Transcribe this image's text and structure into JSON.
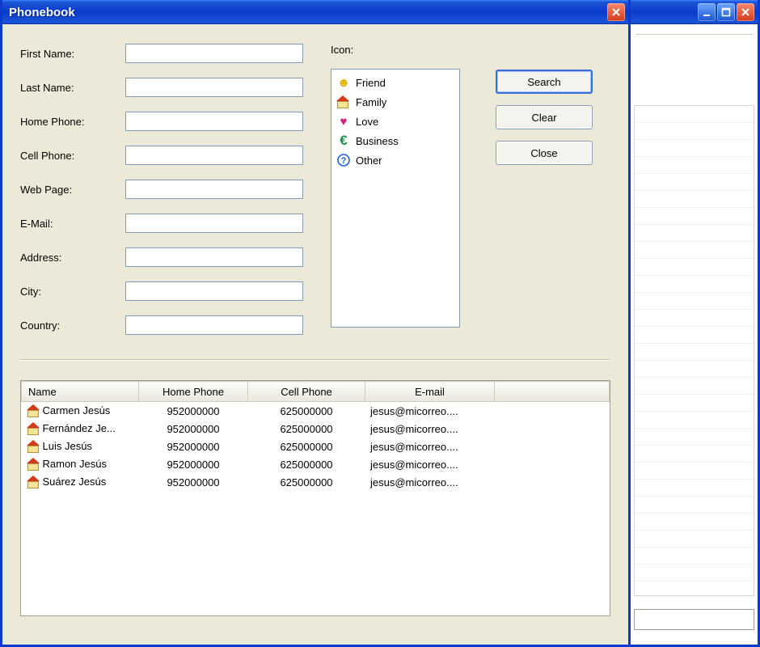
{
  "window": {
    "front_title": "Phonebook",
    "back_title": ""
  },
  "fields": {
    "first_name": {
      "label": "First Name:",
      "value": ""
    },
    "last_name": {
      "label": "Last Name:",
      "value": ""
    },
    "home_phone": {
      "label": "Home Phone:",
      "value": ""
    },
    "cell_phone": {
      "label": "Cell Phone:",
      "value": ""
    },
    "web_page": {
      "label": "Web Page:",
      "value": ""
    },
    "email": {
      "label": "E-Mail:",
      "value": ""
    },
    "address": {
      "label": "Address:",
      "value": ""
    },
    "city": {
      "label": "City:",
      "value": ""
    },
    "country": {
      "label": "Country:",
      "value": ""
    }
  },
  "icon_section": {
    "label": "Icon:",
    "items": [
      {
        "glyph": "😊",
        "label": "Friend",
        "color": "#e4b100"
      },
      {
        "glyph": "🏠",
        "label": "Family",
        "color": "#d23a1a"
      },
      {
        "glyph": "❤",
        "label": "Love",
        "color": "#d0207c"
      },
      {
        "glyph": "€",
        "label": "Business",
        "color": "#159246"
      },
      {
        "glyph": "?",
        "label": "Other",
        "color": "#1863d9"
      }
    ]
  },
  "buttons": {
    "search": "Search",
    "clear": "Clear",
    "close": "Close"
  },
  "table": {
    "headers": [
      "Name",
      "Home Phone",
      "Cell Phone",
      "E-mail",
      ""
    ],
    "rows": [
      {
        "name": "Carmen Jesús",
        "home": "952000000",
        "cell": "625000000",
        "email": "jesus@micorreo...."
      },
      {
        "name": "Fernández Je...",
        "home": "952000000",
        "cell": "625000000",
        "email": "jesus@micorreo...."
      },
      {
        "name": "Luis Jesús",
        "home": "952000000",
        "cell": "625000000",
        "email": "jesus@micorreo...."
      },
      {
        "name": "Ramon Jesús",
        "home": "952000000",
        "cell": "625000000",
        "email": "jesus@micorreo...."
      },
      {
        "name": "Suárez Jesús",
        "home": "952000000",
        "cell": "625000000",
        "email": "jesus@micorreo...."
      }
    ]
  }
}
